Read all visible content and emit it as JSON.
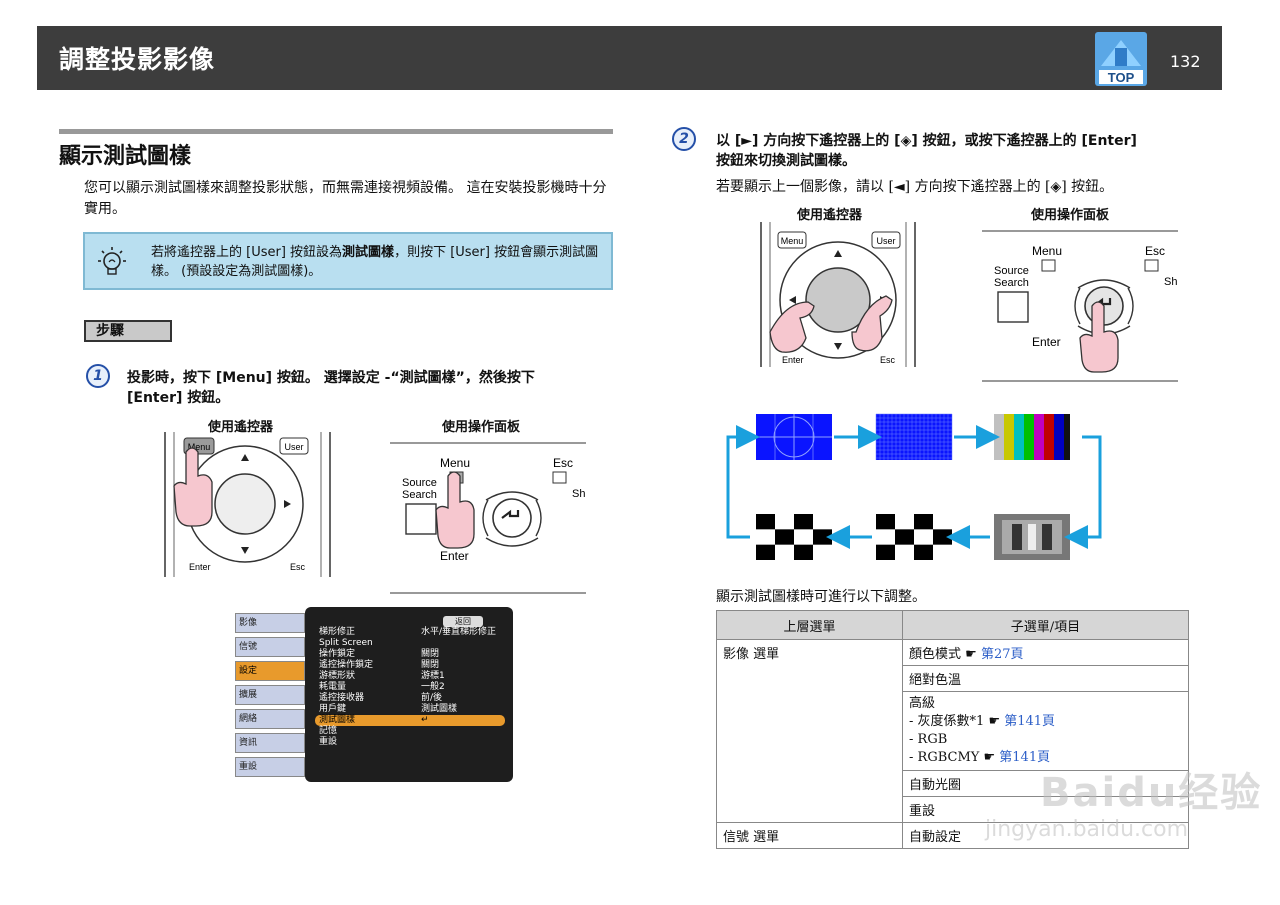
{
  "header": {
    "title": "調整投影影像",
    "top_badge": "TOP",
    "page_number": "132"
  },
  "section": {
    "title": "顯示測試圖樣",
    "intro": "您可以顯示測試圖樣來調整投影狀態，而無需連接視頻設備。 這在安裝投影機時十分實用。"
  },
  "tip": {
    "text_pre": "若將遙控器上的 [User] 按鈕設為",
    "text_bold": "測試圖樣",
    "text_post": "，則按下 [User] 按鈕會顯示測試圖樣。 (預設設定為測試圖樣)。"
  },
  "steps_label": "步驟",
  "step1": {
    "number": "1",
    "line1": "投影時，按下 [Menu] 按鈕。 選擇設定 -“測試圖樣”，然後按下",
    "line2": "[Enter] 按鈕。",
    "caption_remote": "使用遙控器",
    "caption_panel": "使用操作面板"
  },
  "step2": {
    "number": "2",
    "line1": "以 [►] 方向按下遙控器上的 [◈] 按鈕，或按下遙控器上的 [Enter]",
    "line2": "按鈕來切換測試圖樣。",
    "sub": "若要顯示上一個影像，請以 [◄] 方向按下遙控器上的 [◈] 按鈕。",
    "caption_remote": "使用遙控器",
    "caption_panel": "使用操作面板"
  },
  "remote_labels": {
    "menu": "Menu",
    "user": "User",
    "enter": "Enter",
    "esc": "Esc"
  },
  "panel_labels": {
    "menu": "Menu",
    "esc": "Esc",
    "source": "Source",
    "search": "Search",
    "enter": "Enter",
    "sh": "Sh"
  },
  "osd": {
    "left_items": [
      "影像",
      "信號",
      "設定",
      "擴展",
      "網絡",
      "資訊",
      "重設"
    ],
    "active_left": "設定",
    "return_label": "返回",
    "rows": [
      {
        "label": "梯形修正",
        "value": "水平/垂直梯形修正"
      },
      {
        "label": "Split Screen",
        "value": ""
      },
      {
        "label": "操作鎖定",
        "value": "關閉"
      },
      {
        "label": "遙控操作鎖定",
        "value": "關閉"
      },
      {
        "label": "游標形狀",
        "value": "游標1"
      },
      {
        "label": "耗電量",
        "value": "一般2"
      },
      {
        "label": "遙控接收器",
        "value": "前/後"
      },
      {
        "label": "用戶鍵",
        "value": "測試圖樣"
      },
      {
        "label": "測試圖樣",
        "value": "↵"
      },
      {
        "label": "記憶",
        "value": ""
      },
      {
        "label": "重設",
        "value": ""
      }
    ],
    "active_row": "測試圖樣"
  },
  "colors": {
    "header_bg": "#3d3d3d",
    "tip_bg": "#b9dff0",
    "osd_highlight": "#e89a2c",
    "arrow": "#1aa0dd",
    "pattern_blue": "#0a14ff"
  },
  "adjust_caption": "顯示測試圖樣時可進行以下調整。",
  "table": {
    "headers": [
      "上層選單",
      "子選單/項目"
    ],
    "menu_image": "影像 選單",
    "menu_signal": "信號 選單",
    "color_mode": "顏色模式",
    "color_mode_link": "第27頁",
    "abs_temp": "絕對色溫",
    "advanced": "高級",
    "gamma": "- 灰度係數*1",
    "gamma_link": "第141頁",
    "rgb": "- RGB",
    "rgbcmy": "- RGBCMY",
    "rgbcmy_link": "第141頁",
    "auto_iris": "自動光圈",
    "reset": "重設",
    "auto_setup": "自動設定"
  },
  "watermark": {
    "line1": "Baidu经验",
    "line2": "jingyan.baidu.com"
  }
}
